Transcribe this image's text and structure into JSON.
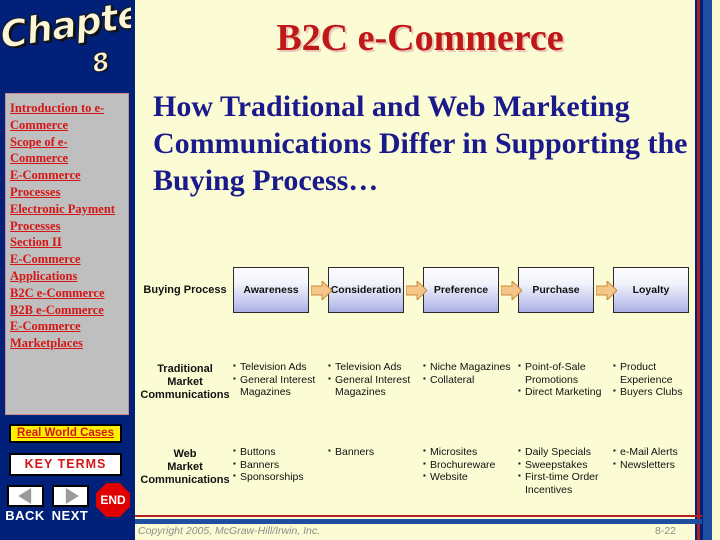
{
  "chapter_banner": {
    "word": "Chapter",
    "number": "8"
  },
  "sidebar": {
    "toc_items": [
      {
        "label": "Introduction to e-Commerce"
      },
      {
        "label": "Scope of e-Commerce"
      },
      {
        "label": "E-Commerce Processes"
      },
      {
        "label": "Electronic Payment Processes"
      },
      {
        "label": "Section II"
      },
      {
        "label": "E-Commerce Applications"
      },
      {
        "label": "B2C e-Commerce"
      },
      {
        "label": "B2B e-Commerce"
      },
      {
        "label": "E-Commerce Marketplaces"
      }
    ],
    "real_world_cases": "Real World Cases",
    "key_terms": "KEY TERMS",
    "back_label": "BACK",
    "next_label": "NEXT",
    "end_label": "END"
  },
  "header": {
    "title": "B2C e-Commerce"
  },
  "main": {
    "heading": "How Traditional and Web Marketing Communications Differ in Supporting the Buying Process…"
  },
  "diagram": {
    "process_row_label": "Buying Process",
    "stages": [
      {
        "label": "Awareness"
      },
      {
        "label": "Consideration"
      },
      {
        "label": "Preference"
      },
      {
        "label": "Purchase"
      },
      {
        "label": "Loyalty"
      }
    ],
    "rows": [
      {
        "label": "Traditional Market Communications",
        "cells": [
          [
            "Television Ads",
            "General Interest",
            "Magazines"
          ],
          [
            "Television Ads",
            "General Interest",
            "Magazines"
          ],
          [
            "Niche Magazines",
            "Collateral"
          ],
          [
            "Point-of-Sale",
            "Promotions",
            "Direct Marketing"
          ],
          [
            "Product",
            "Experience",
            "Buyers Clubs"
          ]
        ],
        "bullets": [
          [
            true,
            true,
            false
          ],
          [
            true,
            true,
            false
          ],
          [
            true,
            true
          ],
          [
            true,
            false,
            true
          ],
          [
            true,
            false,
            true
          ]
        ]
      },
      {
        "label": "Web Market Communications",
        "cells": [
          [
            "Buttons",
            "Banners",
            "Sponsorships"
          ],
          [
            "Banners"
          ],
          [
            "Microsites",
            "Brochureware",
            "Website"
          ],
          [
            "Daily Specials",
            "Sweepstakes",
            "First-time Order",
            "Incentives"
          ],
          [
            "e-Mail Alerts",
            "Newsletters"
          ]
        ],
        "bullets": [
          [
            true,
            true,
            true
          ],
          [
            true
          ],
          [
            true,
            true,
            true
          ],
          [
            true,
            true,
            true,
            false
          ],
          [
            true,
            true
          ]
        ]
      }
    ]
  },
  "footer": {
    "copyright": "Copyright 2005, McGraw-Hill/Irwin, Inc.",
    "page_number": "8-22"
  },
  "colors": {
    "nav_background": "#00207a",
    "content_background": "#fcfcd4",
    "title_red": "#c01818",
    "heading_navy": "#1a1a8c",
    "link_red": "#d41616",
    "highlight_yellow": "#fff000",
    "end_red": "#e00000",
    "arrow_orange": "#f5c58a"
  }
}
